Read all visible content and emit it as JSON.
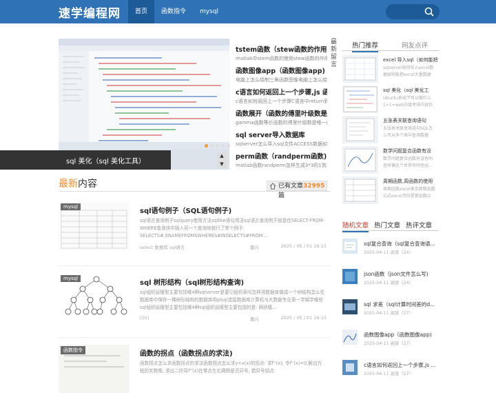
{
  "site": {
    "logo": "速学编程网"
  },
  "nav": [
    {
      "label": "首页"
    },
    {
      "label": "函数指令"
    },
    {
      "label": "mysql"
    }
  ],
  "slider": {
    "caption": "sql 美化（sql 美化工具）",
    "up": "▲",
    "down": "▼"
  },
  "headlines": [
    {
      "title": "tstem函数（stew函数的作用)",
      "desc": "matlab中stem函数的使用stew函数的作用matl..."
    },
    {
      "title": "函数图像app（函数图像app)",
      "desc": "电脑上怎么绘制三角函数图像电脑上怎么绘制..."
    },
    {
      "title": "c语言如何返回上一个步骤,js 函",
      "desc": "c语言如何返回上一个步骤C语言中return到底..."
    },
    {
      "title": "函数展开（函数的傅里叶级数是",
      "desc": "gamma函数等价函数的傅里叶级数是唯一的吗..."
    },
    {
      "title": "sql server导入数据库",
      "desc": "sqlserver怎么导入sql文件ACCESS数据如何导..."
    },
    {
      "title": "perm函数（randperm函数)",
      "desc": "matlab函数randperm怎样生成3*3的1到10的随..."
    }
  ],
  "vertical_tag": "最新留言",
  "latest": {
    "title_hi": "最新",
    "title_rest": "内容",
    "count_prefix": "已有文章",
    "count": "32995",
    "count_suffix": "篇"
  },
  "articles": [
    {
      "badge": "mysql",
      "title": "sql语句例子（SQL语句例子)",
      "summary": "sql语言查询例子sqlquery使用方法sqllike语句用法sql语言查询例子就是在SELECT-FROM-WHERE查询块中插入另一个查询块就行了举个例子: SELECTS#,SNAMEFROMSWHERES#INSELECTS#FROM...",
      "tags": "select  数据库  sql语言",
      "author": "嘉兴",
      "date": "2025 / 05 / 01 16:15"
    },
    {
      "badge": "mysql",
      "title": "sql 树形结构（sql树形结构查询)",
      "summary": "sql组织层模型主要包括哪4种sqlserver是要引组织表吗怎样用数据库做成一个树结构怎么在数据库中保存一棵树形结构的数据库用plsql连接数据库计算机与大数据专业第一学期学哪些sql组织层模型主要包括哪4种sql组织层模型主要包括的是: 网状模...",
      "tags": "[20]",
      "author": "嘉兴",
      "date": "2025 / 05 / 01 16:15"
    },
    {
      "badge": "函数指令",
      "title": "函数的拐点（函数拐点的求法)",
      "summary": "函数拐点怎么求函数拐点的求法函数拐点怎么求y=x(x)的拐点: 求f''(x); 令f''(x)=0,解出方程的实数根, 求出二阶导f''(x)在零点左右两侧是否异号, 若异号拐点",
      "tags": "",
      "author": "",
      "date": ""
    }
  ],
  "sidebar": {
    "tabs": [
      {
        "label": "热门推荐"
      },
      {
        "label": "网友点评"
      }
    ],
    "recommend": [
      {
        "title": "excel 导入sql（如何能把",
        "desc": "sqlserver如何导入excel数据如何能把excel大量数据导..."
      },
      {
        "title": "sql 美化（sql 美化工",
        "desc": "Ubuntu系统下可以做什么1+1=web中级考核内容包括什么..."
      },
      {
        "title": "五张表关联查询语句",
        "desc": "五张表关联查询语句SQL怎么写从多个表中查询数据的..."
      },
      {
        "title": "数学问题复合函数有没",
        "desc": "数学问题复合函数有没有同音异偶这个世界有同音函..."
      },
      {
        "title": "周期函数,周函数的使用",
        "desc": "周期函数excel表余周数函数公式excel月份是那函数公式..."
      }
    ],
    "tabs2": [
      {
        "label": "随机文章"
      },
      {
        "label": "热门文章"
      },
      {
        "label": "热评文章"
      }
    ],
    "random": [
      {
        "title": "sql复合查询（sql复合查询语...",
        "meta": "2025-04-11  阅读（24）"
      },
      {
        "title": "json函数（json文件怎么写)",
        "meta": "2025-04-11  阅读（24）"
      },
      {
        "title": "sql 求差（sql计算时间差的d...",
        "meta": "2025-04-11  阅读（27）"
      },
      {
        "title": "函数图像app（函数图像app)",
        "meta": "2025-04-11  阅读（27）"
      },
      {
        "title": "c语言如何返回上一个步骤,js ...",
        "meta": "2025-04-11  阅读（27）"
      }
    ]
  }
}
